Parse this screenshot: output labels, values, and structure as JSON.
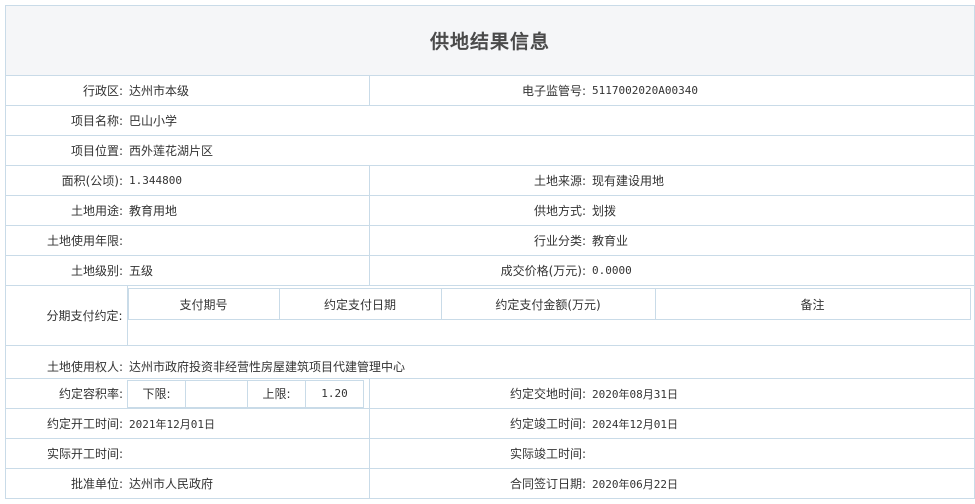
{
  "title": "供地结果信息",
  "rows": {
    "district_label": "行政区:",
    "district_value": "达州市本级",
    "supervision_no_label": "电子监管号:",
    "supervision_no_value": "5117002020A00340",
    "project_name_label": "项目名称:",
    "project_name_value": "巴山小学",
    "project_location_label": "项目位置:",
    "project_location_value": "西外莲花湖片区",
    "area_label": "面积(公顷):",
    "area_value": "1.344800",
    "land_source_label": "土地来源:",
    "land_source_value": "现有建设用地",
    "land_use_label": "土地用途:",
    "land_use_value": "教育用地",
    "supply_method_label": "供地方式:",
    "supply_method_value": "划拨",
    "use_period_label": "土地使用年限:",
    "use_period_value": "",
    "industry_label": "行业分类:",
    "industry_value": "教育业",
    "land_grade_label": "土地级别:",
    "land_grade_value": "五级",
    "deal_price_label": "成交价格(万元):",
    "deal_price_value": "0.0000",
    "installment_label": "分期支付约定:",
    "installment_headers": [
      "支付期号",
      "约定支付日期",
      "约定支付金额(万元)",
      "备注"
    ],
    "owner_label": "土地使用权人:",
    "owner_value": "达州市政府投资非经营性房屋建筑项目代建管理中心",
    "far_label": "约定容积率:",
    "far_lower_label": "下限:",
    "far_lower_value": "",
    "far_upper_label": "上限:",
    "far_upper_value": "1.20",
    "delivery_time_label": "约定交地时间:",
    "delivery_time_value": "2020年08月31日",
    "start_time_label": "约定开工时间:",
    "start_time_value": "2021年12月01日",
    "completion_time_label": "约定竣工时间:",
    "completion_time_value": "2024年12月01日",
    "actual_start_label": "实际开工时间:",
    "actual_start_value": "",
    "actual_completion_label": "实际竣工时间:",
    "actual_completion_value": "",
    "approval_unit_label": "批准单位:",
    "approval_unit_value": "达州市人民政府",
    "contract_date_label": "合同签订日期:",
    "contract_date_value": "2020年06月22日"
  }
}
